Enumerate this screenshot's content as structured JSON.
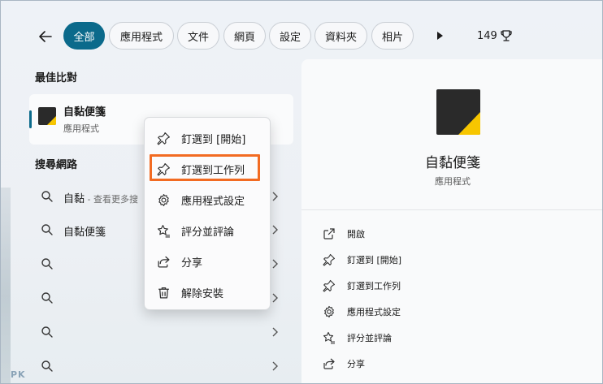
{
  "header": {
    "filters": [
      {
        "label": "全部",
        "active": true
      },
      {
        "label": "應用程式"
      },
      {
        "label": "文件"
      },
      {
        "label": "網頁"
      },
      {
        "label": "設定"
      },
      {
        "label": "資料夾"
      },
      {
        "label": "相片"
      }
    ],
    "points": "149"
  },
  "left": {
    "best_match_title": "最佳比對",
    "best_match": {
      "name": "自黏便箋",
      "type": "應用程式"
    },
    "web_title": "搜尋網路",
    "web_results": [
      {
        "text": "自黏",
        "sub": " - 查看更多搜"
      },
      {
        "text": "自黏便箋",
        "sub": ""
      },
      {
        "text": "",
        "sub": ""
      },
      {
        "text": "",
        "sub": ""
      },
      {
        "text": "",
        "sub": ""
      },
      {
        "text": "",
        "sub": ""
      }
    ]
  },
  "context_menu": {
    "items": [
      {
        "label": "釘選到 [開始]",
        "icon": "pin-icon"
      },
      {
        "label": "釘選到工作列",
        "icon": "pin-icon"
      },
      {
        "label": "應用程式設定",
        "icon": "gear-icon"
      },
      {
        "label": "評分並評論",
        "icon": "star-review-icon"
      },
      {
        "label": "分享",
        "icon": "share-icon"
      },
      {
        "label": "解除安裝",
        "icon": "trash-icon"
      }
    ]
  },
  "detail": {
    "name": "自黏便箋",
    "type": "應用程式",
    "actions": [
      {
        "label": "開啟",
        "icon": "open-external-icon"
      },
      {
        "label": "釘選到 [開始]",
        "icon": "pin-icon"
      },
      {
        "label": "釘選到工作列",
        "icon": "pin-icon"
      },
      {
        "label": "應用程式設定",
        "icon": "gear-icon"
      },
      {
        "label": "評分並評論",
        "icon": "star-review-icon"
      },
      {
        "label": "分享",
        "icon": "share-icon"
      }
    ]
  },
  "watermark": "PK",
  "colors": {
    "accent": "#0b6a8b",
    "highlight": "#f26b22",
    "sticky_yellow": "#f7c600"
  }
}
